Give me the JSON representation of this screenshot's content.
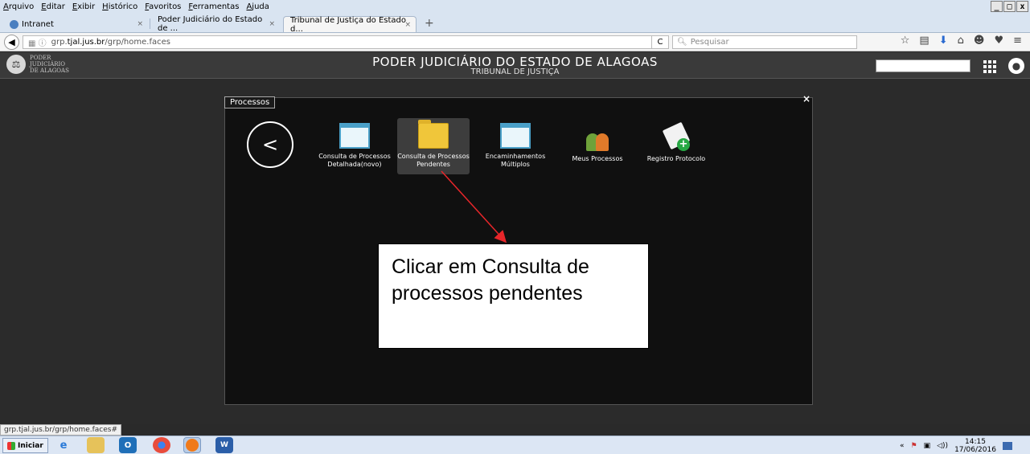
{
  "menubar": {
    "items": [
      "Arquivo",
      "Editar",
      "Exibir",
      "Histórico",
      "Favoritos",
      "Ferramentas",
      "Ajuda"
    ],
    "window_controls": [
      "_",
      "□",
      "x"
    ]
  },
  "tabs": [
    {
      "label": "Intranet",
      "active": false
    },
    {
      "label": "Poder Judiciário do Estado de ...",
      "active": false
    },
    {
      "label": "Tribunal de Justiça do Estado d...",
      "active": true
    }
  ],
  "newtab": "+",
  "nav": {
    "url_prefix": "grp.",
    "url_host": "tjal.jus.br",
    "url_path": "/grp/home.faces",
    "reload": "C",
    "search_placeholder": "Pesquisar",
    "icons": [
      "star-icon",
      "clipboard-icon",
      "download-icon",
      "home-icon",
      "chat-icon",
      "pocket-icon",
      "menu-icon"
    ]
  },
  "header": {
    "logo_line1": "PODER",
    "logo_line2": "JUDICIÁRIO",
    "logo_line3": "DE ALAGOAS",
    "title": "PODER JUDICIÁRIO DO ESTADO DE ALAGOAS",
    "subtitle": "TRIBUNAL DE JUSTIÇA"
  },
  "modal": {
    "tab_label": "Processos",
    "close": "×",
    "back": "<",
    "tiles": [
      {
        "label": "Consulta de Processos Detalhada(novo)",
        "icon": "window-icon",
        "selected": false
      },
      {
        "label": "Consulta de Processos Pendentes",
        "icon": "folder-icon",
        "selected": true
      },
      {
        "label": "Encaminhamentos Múltiplos",
        "icon": "window-icon",
        "selected": false
      },
      {
        "label": "Meus Processos",
        "icon": "people-icon",
        "selected": false
      },
      {
        "label": "Registro Protocolo",
        "icon": "document-add-icon",
        "selected": false
      }
    ]
  },
  "callout": {
    "text": "Clicar em Consulta de processos pendentes"
  },
  "statusbar": {
    "text": "grp.tjal.jus.br/grp/home.faces#"
  },
  "taskbar": {
    "start_label": "Iniciar",
    "time": "14:15",
    "date": "17/06/2016",
    "tray_chevron": "«"
  },
  "colors": {
    "accent_arrow": "#e8262a",
    "modal_bg": "#101010",
    "header_bg": "#3a3a3a"
  }
}
